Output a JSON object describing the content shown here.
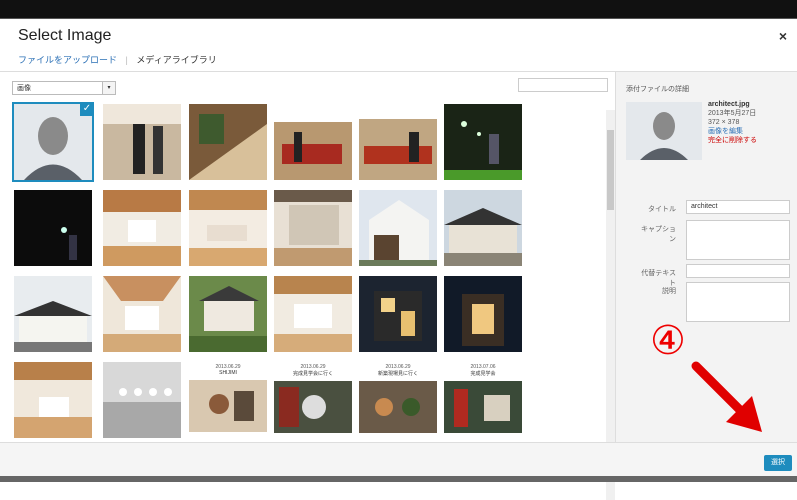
{
  "modal": {
    "title": "Select Image",
    "close": "×",
    "tabs": [
      {
        "label": "ファイルをアップロード"
      },
      {
        "label": "メディアライブラリ"
      }
    ]
  },
  "toolbar": {
    "filter_selected": "画像"
  },
  "sidebar": {
    "heading": "添付ファイルの詳細",
    "filename": "architect.jpg",
    "date": "2013年5月27日",
    "dimensions": "372 × 378",
    "edit_link": "画像を編集",
    "delete_link": "完全に削除する",
    "fields": {
      "title_label": "タイトル",
      "title_value": "architect",
      "caption_label": "キャプション",
      "alt_label": "代替テキスト",
      "desc_label": "説明"
    }
  },
  "footer": {
    "select_label": "選択"
  },
  "annotation": {
    "step": "④",
    "arrow_color": "#e00000"
  },
  "thumbs": {
    "row4_captions": [
      {
        "date": "2013.06.29",
        "name": "SHIJIMI"
      },
      {
        "date": "2013.06.29",
        "name": "完成見学会に行く"
      },
      {
        "date": "2013.06.29",
        "name": "新築現場見に行く"
      },
      {
        "date": "2013.07.06",
        "name": "完成見学会"
      }
    ]
  }
}
